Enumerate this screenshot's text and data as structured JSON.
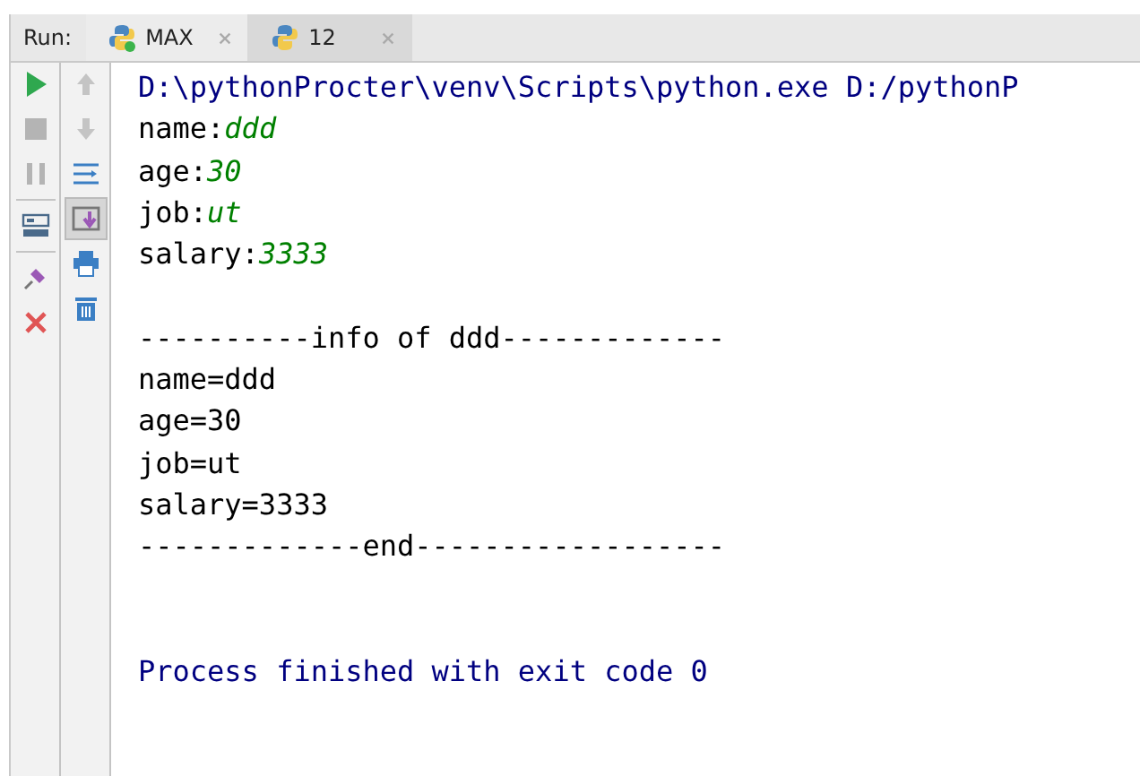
{
  "run_panel": {
    "label": "Run:",
    "tabs": [
      {
        "label": "MAX",
        "selected": false,
        "running": true
      },
      {
        "label": "12",
        "selected": true,
        "running": false
      }
    ]
  },
  "console": {
    "lines": [
      {
        "kind": "command",
        "text": "D:\\pythonProcter\\venv\\Scripts\\python.exe D:/pythonP"
      },
      {
        "kind": "input",
        "prompt": "name:",
        "value": "ddd"
      },
      {
        "kind": "input",
        "prompt": "age:",
        "value": "30"
      },
      {
        "kind": "input",
        "prompt": "job:",
        "value": "ut"
      },
      {
        "kind": "input",
        "prompt": "salary:",
        "value": "3333"
      },
      {
        "kind": "blank"
      },
      {
        "kind": "output",
        "text": "----------info of ddd-------------"
      },
      {
        "kind": "output",
        "text": "name=ddd"
      },
      {
        "kind": "output",
        "text": "age=30"
      },
      {
        "kind": "output",
        "text": "job=ut"
      },
      {
        "kind": "output",
        "text": "salary=3333"
      },
      {
        "kind": "output",
        "text": "-------------end------------------"
      },
      {
        "kind": "blank"
      },
      {
        "kind": "blank"
      },
      {
        "kind": "system",
        "text": "Process finished with exit code 0"
      }
    ]
  }
}
